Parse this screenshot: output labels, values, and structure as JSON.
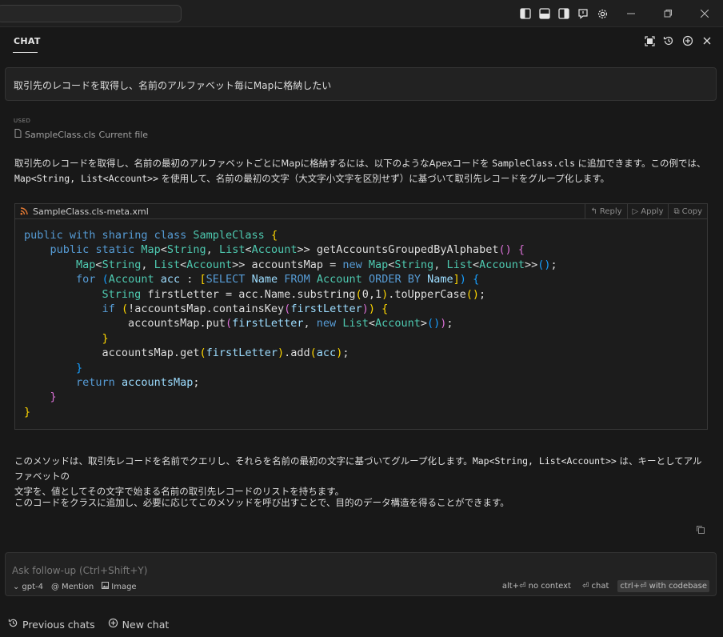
{
  "header": {
    "title": "CHAT"
  },
  "user_message": "取引先のレコードを取得し、名前のアルファベット毎にMapに格納したい",
  "context": {
    "used_label": "USED",
    "file_name": "SampleClass.cls",
    "file_note": "Current file"
  },
  "response": {
    "intro_line1_a": "取引先のレコードを取得し、名前の最初のアルファベットごとにMapに格納するには、以下のようなApexコードを ",
    "intro_line1_code": "SampleClass.cls",
    "intro_line1_b": " に追加できます。この例では、",
    "intro_line2_code": "Map<String, List<Account>>",
    "intro_line2_b": " を使用して、名前の最初の文字（大文字小文字を区別せず）に基づいて取引先レコードをグループ化します。",
    "code_file": "SampleClass.cls-meta.xml",
    "code_actions": {
      "reply": "Reply",
      "apply": "Apply",
      "copy": "Copy"
    },
    "outro1_a": "このメソッドは、取引先レコードを名前でクエリし、それらを名前の最初の文字に基づいてグループ化します。",
    "outro1_code": "Map<String, List<Account>>",
    "outro1_b": " は、キーとしてアルファベットの",
    "outro1_line2": "文字を、値としてその文字で始まる名前の取引先レコードのリストを持ちます。",
    "outro2": "このコードをクラスに追加し、必要に応じてこのメソッドを呼び出すことで、目的のデータ構造を得ることができます。"
  },
  "input": {
    "placeholder": "Ask follow-up (Ctrl+Shift+Y)",
    "model": "gpt-4",
    "mention": "Mention",
    "image": "Image",
    "opt_no_context": "alt+⏎ no context",
    "opt_chat": "⏎ chat",
    "opt_codebase": "ctrl+⏎ with codebase"
  },
  "footer": {
    "previous": "Previous chats",
    "new_chat": "New chat"
  },
  "icons": {
    "layout": [
      "sidebar-left-icon",
      "panel-bottom-icon",
      "sidebar-right-icon",
      "feedback-icon",
      "gear-icon"
    ],
    "window": [
      "minimize-icon",
      "restore-icon",
      "close-icon"
    ],
    "chat_header": [
      "maximize-icon",
      "history-icon",
      "plus-circle-icon",
      "close-icon"
    ]
  }
}
